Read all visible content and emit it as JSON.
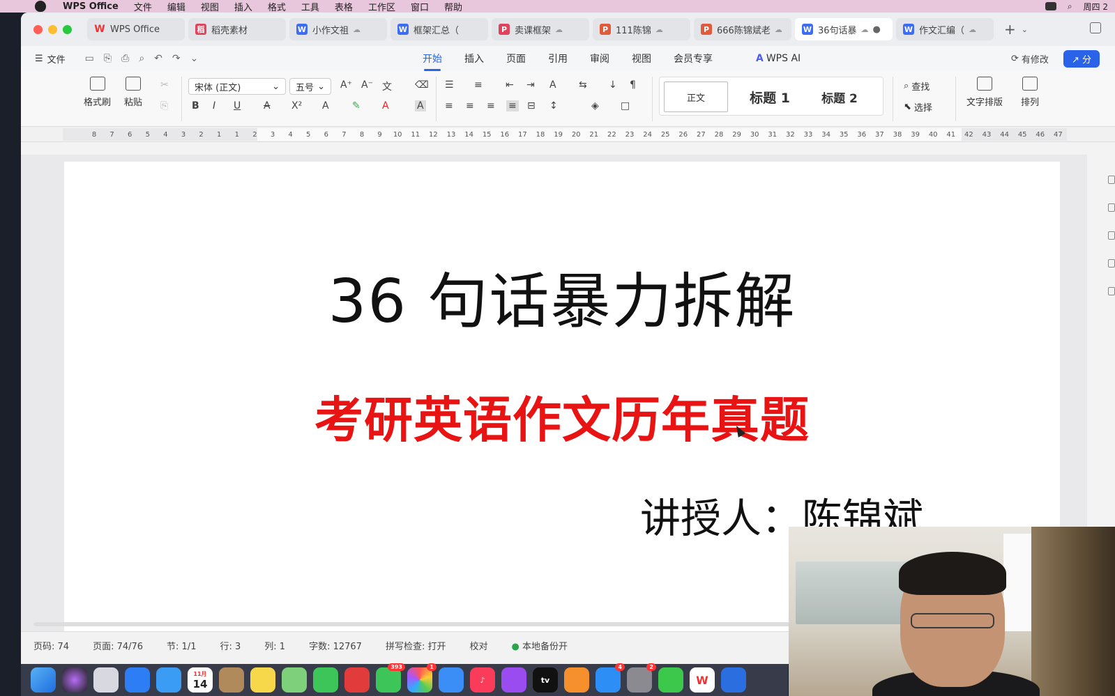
{
  "menubar": {
    "app_name": "WPS Office",
    "menus": [
      "文件",
      "编辑",
      "视图",
      "插入",
      "格式",
      "工具",
      "表格",
      "工作区",
      "窗口",
      "帮助"
    ],
    "clock": "周四 2"
  },
  "tabs": [
    {
      "label": "WPS Office",
      "icon": "wps-logo-icon",
      "active": false
    },
    {
      "label": "稻壳素材",
      "icon": "daoke-icon",
      "active": false
    },
    {
      "label": "小作文祖",
      "icon": "word-doc-icon",
      "active": false
    },
    {
      "label": "框架汇总（",
      "icon": "word-doc-icon",
      "active": false
    },
    {
      "label": "卖课框架",
      "icon": "pdf-icon",
      "active": false
    },
    {
      "label": "111陈锦",
      "icon": "ppt-icon",
      "active": false
    },
    {
      "label": "666陈锦斌老",
      "icon": "ppt-icon",
      "active": false
    },
    {
      "label": "36句话暴",
      "icon": "word-doc-icon",
      "active": true
    },
    {
      "label": "作文汇编（",
      "icon": "word-doc-icon",
      "active": false
    }
  ],
  "menu_row": {
    "file_label": "文件",
    "ribbon_tabs": [
      "开始",
      "插入",
      "页面",
      "引用",
      "审阅",
      "视图",
      "会员专享"
    ],
    "active_tab": "开始",
    "wps_ai": "WPS AI",
    "changed": "有修改",
    "share": "分"
  },
  "ribbon": {
    "format_painter": "格式刷",
    "paste": "粘贴",
    "font_name": "宋体 (正文)",
    "font_size": "五号",
    "styles": {
      "normal": "正文",
      "h1": "标题 1",
      "h2": "标题 2"
    },
    "find": "查找",
    "select": "选择",
    "text_layout": "文字排版",
    "arrange": "排列"
  },
  "ruler_ticks": [
    "8",
    "7",
    "6",
    "5",
    "4",
    "3",
    "2",
    "1",
    "1",
    "2",
    "3",
    "4",
    "5",
    "6",
    "7",
    "8",
    "9",
    "10",
    "11",
    "12",
    "13",
    "14",
    "15",
    "16",
    "17",
    "18",
    "19",
    "20",
    "21",
    "22",
    "23",
    "24",
    "25",
    "26",
    "27",
    "28",
    "29",
    "30",
    "31",
    "32",
    "33",
    "34",
    "35",
    "36",
    "37",
    "38",
    "39",
    "40",
    "41",
    "42",
    "43",
    "44",
    "45",
    "46",
    "47"
  ],
  "document": {
    "title": "36 句话暴力拆解",
    "subtitle": "考研英语作文历年真题",
    "author": "讲授人：陈锦斌"
  },
  "status": {
    "page_num": "页码: 74",
    "page": "页面: 74/76",
    "section": "节: 1/1",
    "row": "行: 3",
    "col": "列: 1",
    "word_count": "字数: 12767",
    "spell_check": "拼写检查: 打开",
    "proofread": "校对",
    "backup": "本地备份开"
  },
  "dock": {
    "date_day": "14",
    "date_month": "11月",
    "badges": {
      "messages": "393",
      "photos": "1",
      "appstore": "4",
      "settings": "2"
    },
    "tv_label": "tv"
  },
  "colors": {
    "accent": "#2a62e8",
    "title_red": "#e81313"
  }
}
